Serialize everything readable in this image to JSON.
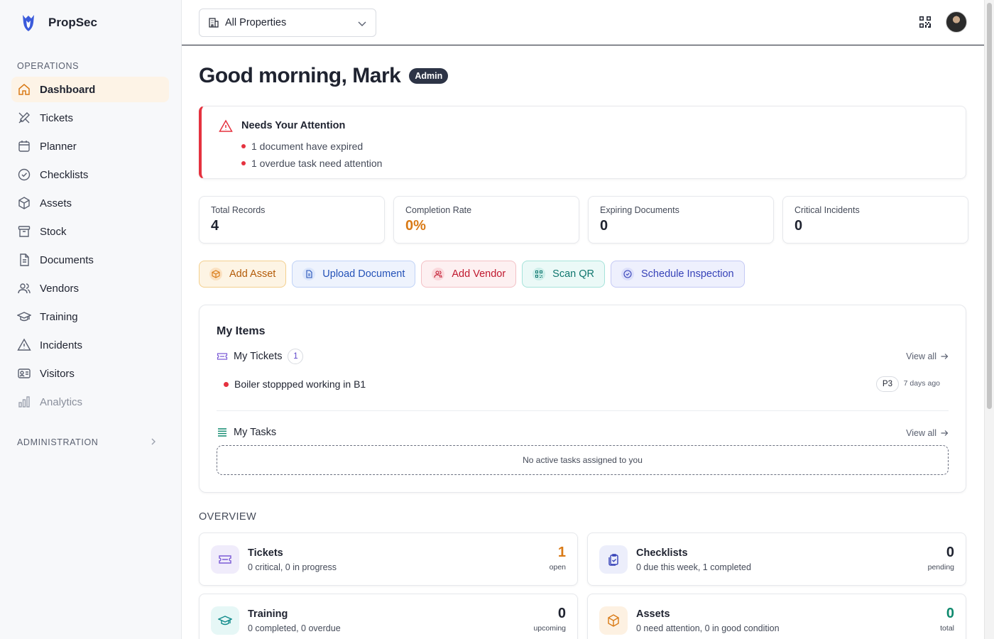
{
  "app": {
    "name": "PropSec"
  },
  "sidebar": {
    "operations_label": "OPERATIONS",
    "items": [
      {
        "label": "Dashboard",
        "icon": "home-icon"
      },
      {
        "label": "Tickets",
        "icon": "tools-icon"
      },
      {
        "label": "Planner",
        "icon": "calendar-icon"
      },
      {
        "label": "Checklists",
        "icon": "check-circle-icon"
      },
      {
        "label": "Assets",
        "icon": "box-icon"
      },
      {
        "label": "Stock",
        "icon": "archive-icon"
      },
      {
        "label": "Documents",
        "icon": "document-icon"
      },
      {
        "label": "Vendors",
        "icon": "users-icon"
      },
      {
        "label": "Training",
        "icon": "graduation-cap-icon"
      },
      {
        "label": "Incidents",
        "icon": "warning-icon"
      },
      {
        "label": "Visitors",
        "icon": "id-card-icon"
      },
      {
        "label": "Analytics",
        "icon": "bar-chart-icon"
      }
    ],
    "administration_label": "ADMINISTRATION"
  },
  "topbar": {
    "property_select": "All Properties"
  },
  "greeting": {
    "text": "Good morning, Mark",
    "role_badge": "Admin"
  },
  "alert": {
    "title": "Needs Your Attention",
    "items": [
      "1 document have expired",
      "1 overdue task need attention"
    ],
    "accent": "#e5323f"
  },
  "stats": [
    {
      "label": "Total Records",
      "value": "4"
    },
    {
      "label": "Completion Rate",
      "value": "0%"
    },
    {
      "label": "Expiring Documents",
      "value": "0"
    },
    {
      "label": "Critical Incidents",
      "value": "0"
    }
  ],
  "actions": [
    {
      "label": "Add Asset",
      "icon": "box-icon"
    },
    {
      "label": "Upload Document",
      "icon": "document-icon"
    },
    {
      "label": "Add Vendor",
      "icon": "users-icon"
    },
    {
      "label": "Scan QR",
      "icon": "qr-icon"
    },
    {
      "label": "Schedule Inspection",
      "icon": "check-circle-icon"
    }
  ],
  "my_items": {
    "title": "My Items",
    "tickets": {
      "label": "My Tickets",
      "count": "1",
      "view_all": "View all",
      "rows": [
        {
          "title": "Boiler stoppped working in B1",
          "priority": "P3",
          "age": "7 days ago"
        }
      ]
    },
    "tasks": {
      "label": "My Tasks",
      "view_all": "View all",
      "empty": "No active tasks assigned to you"
    }
  },
  "overview": {
    "label": "OVERVIEW",
    "cards": [
      {
        "name": "Tickets",
        "sub": "0 critical, 0 in progress",
        "value": "1",
        "unit": "open",
        "color": "#d97a16"
      },
      {
        "name": "Checklists",
        "sub": "0 due this week, 1 completed",
        "value": "0",
        "unit": "pending",
        "color": "#1f2330"
      },
      {
        "name": "Training",
        "sub": "0 completed, 0 overdue",
        "value": "0",
        "unit": "upcoming",
        "color": "#1f2330"
      },
      {
        "name": "Assets",
        "sub": "0 need attention, 0 in good condition",
        "value": "0",
        "unit": "total",
        "color": "#0f8a6e"
      }
    ]
  }
}
